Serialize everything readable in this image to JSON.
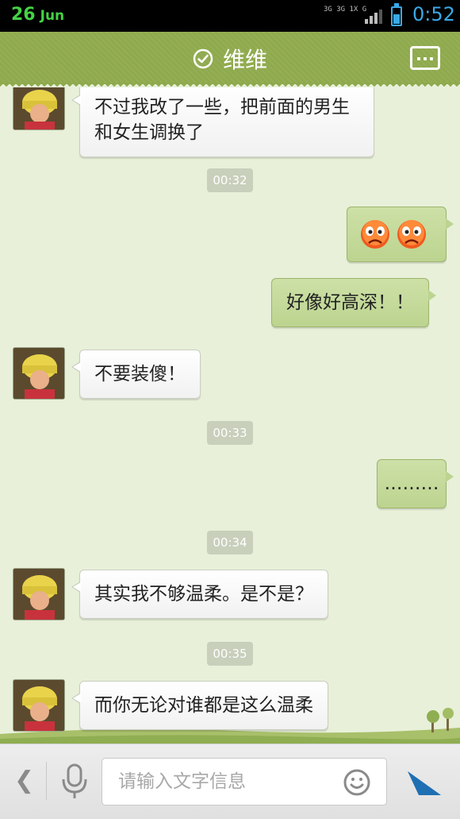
{
  "status_bar": {
    "day": "26",
    "month": "Jun",
    "network": "3G 3G 1X G",
    "time": "0:52",
    "colors": {
      "date": "#44d244",
      "time": "#3aa9e6"
    }
  },
  "header": {
    "title": "维维",
    "icons": [
      "check-circle-icon",
      "more-menu-icon"
    ],
    "color": "#8faa4d"
  },
  "messages": [
    {
      "type": "in",
      "text": "不过我改了一些，把前面的男生和女生调换了"
    },
    {
      "type": "time",
      "text": "00:32"
    },
    {
      "type": "out",
      "content": "emoji",
      "emoji": [
        "angry-face-icon",
        "angry-face-icon"
      ]
    },
    {
      "type": "out",
      "text": "好像好高深！！"
    },
    {
      "type": "in",
      "text": "不要装傻！"
    },
    {
      "type": "time",
      "text": "00:33"
    },
    {
      "type": "out",
      "text": "………"
    },
    {
      "type": "time",
      "text": "00:34"
    },
    {
      "type": "in",
      "text": "其实我不够温柔。是不是？"
    },
    {
      "type": "time",
      "text": "00:35"
    },
    {
      "type": "in",
      "text": "而你无论对谁都是这么温柔"
    }
  ],
  "input_bar": {
    "placeholder": "请输入文字信息",
    "icons": [
      "back-chevron-icon",
      "microphone-icon",
      "smiley-icon",
      "send-icon"
    ]
  }
}
